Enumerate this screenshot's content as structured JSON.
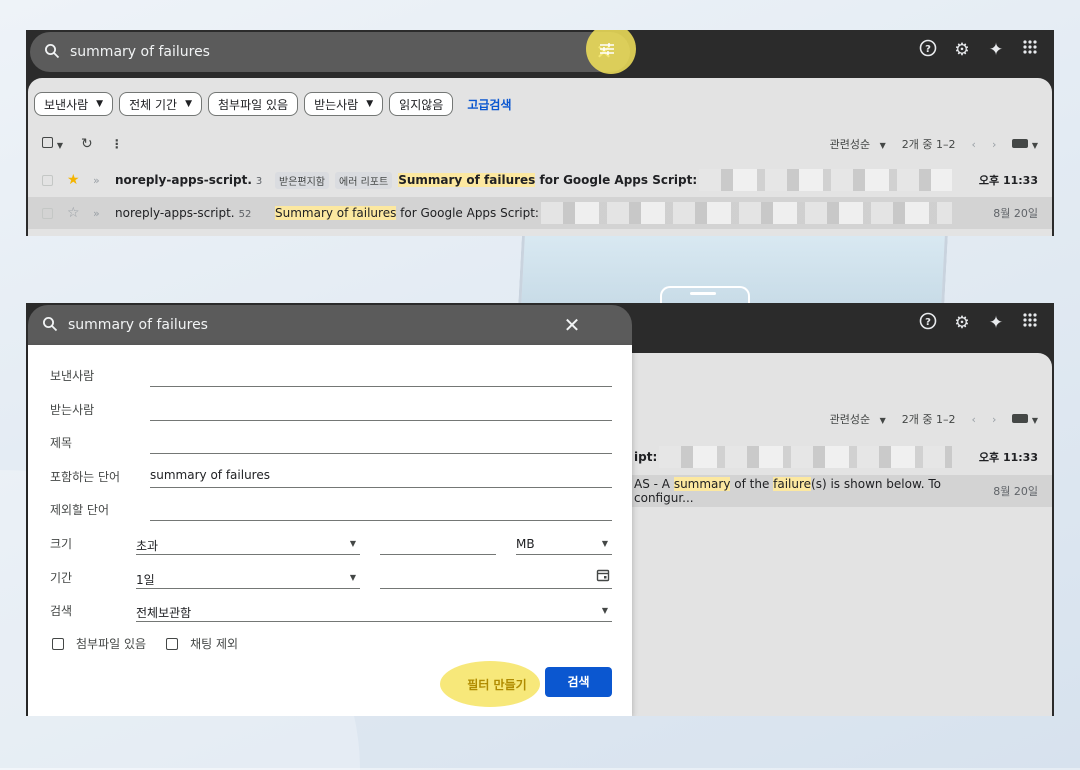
{
  "colors": {
    "topbar": "#2b2b2b",
    "accent_blue": "#0b57d0",
    "highlight": "#fce8a0",
    "marker": "#f3e35a"
  },
  "top": {
    "search": {
      "query": "summary of failures"
    },
    "icons": [
      "help-icon",
      "settings-icon",
      "gemini-sparkle-icon",
      "apps-grid-icon"
    ],
    "chips": [
      {
        "label": "보낸사람",
        "dropdown": true
      },
      {
        "label": "전체 기간",
        "dropdown": true
      },
      {
        "label": "첨부파일 있음",
        "dropdown": false
      },
      {
        "label": "받는사람",
        "dropdown": true
      },
      {
        "label": "읽지않음",
        "dropdown": false
      }
    ],
    "advanced_link": "고급검색",
    "sort_label": "관련성순",
    "page_info": "2개 중 1–2",
    "emails": [
      {
        "starred": true,
        "sender": "noreply-apps-script.",
        "count": "3",
        "labels": [
          "받은편지함",
          "에러 리포트"
        ],
        "subject_highlight": "Summary of failures",
        "subject_rest": " for Google Apps Script: ",
        "date": "오후 11:33",
        "unread": true
      },
      {
        "starred": false,
        "sender": "noreply-apps-script.",
        "count": "52",
        "labels": [],
        "subject_highlight": "Summary of failures",
        "subject_rest": " for Google Apps Script:",
        "date": "8월 20일",
        "unread": false
      }
    ]
  },
  "bottom": {
    "search": {
      "query": "summary of failures"
    },
    "sort_label": "관련성순",
    "page_info": "2개 중 1–2",
    "visible_rows": [
      {
        "text": "ipt:",
        "date": "오후 11:33"
      },
      {
        "prefix": "AS - A ",
        "hl1": "summary",
        "mid": " of the ",
        "hl2": "failure",
        "rest": "(s) is shown below. To configur...",
        "date": "8월 20일"
      }
    ],
    "form": {
      "from_label": "보낸사람",
      "to_label": "받는사람",
      "subject_label": "제목",
      "has_words_label": "포함하는 단어",
      "has_words_value": "summary of failures",
      "exclude_label": "제외할 단어",
      "size_label": "크기",
      "size_op": "초과",
      "size_unit": "MB",
      "date_label": "기간",
      "date_value": "1일",
      "scope_label": "검색",
      "scope_value": "전체보관함",
      "attach_label": "첨부파일 있음",
      "no_chat_label": "채팅 제외",
      "create_filter_label": "필터 만들기",
      "search_button_label": "검색"
    }
  }
}
